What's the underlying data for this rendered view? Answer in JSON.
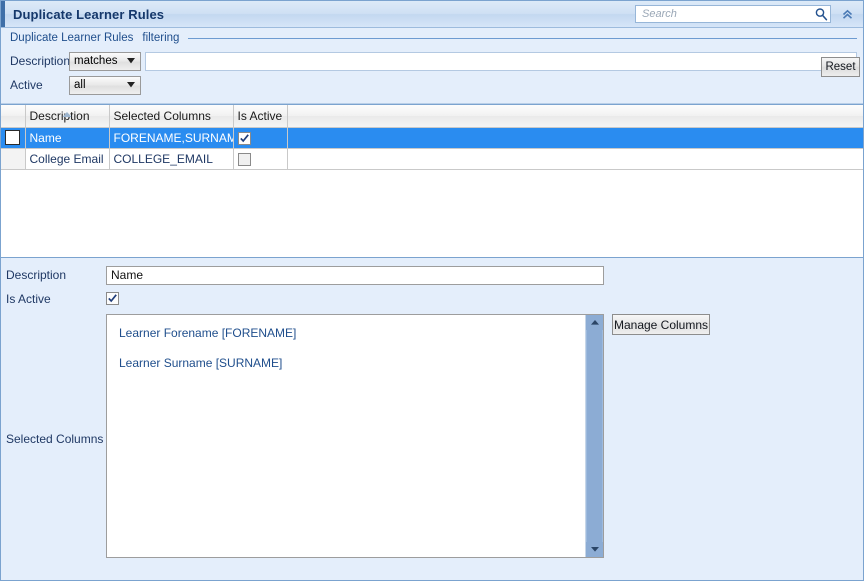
{
  "window": {
    "title": "Duplicate Learner Rules",
    "collapse_icon": "double-chevron-up-icon"
  },
  "search": {
    "placeholder": "Search",
    "value": "",
    "icon": "magnifier-icon"
  },
  "filter": {
    "group_title": "Duplicate Learner Rules",
    "group_subtitle": "filtering",
    "reset_label": "Reset",
    "rows": [
      {
        "label": "Description",
        "operator": "matches",
        "value": "",
        "has_text_input": true
      },
      {
        "label": "Active",
        "operator": "all",
        "has_text_input": false
      }
    ]
  },
  "grid": {
    "columns": [
      {
        "key": "selector",
        "label": ""
      },
      {
        "key": "description",
        "label": "Description",
        "sorted": "asc"
      },
      {
        "key": "selected_columns",
        "label": "Selected Columns"
      },
      {
        "key": "is_active",
        "label": "Is Active"
      },
      {
        "key": "filler",
        "label": ""
      }
    ],
    "rows": [
      {
        "description": "Name",
        "selected_columns": "FORENAME,SURNAME",
        "is_active": true,
        "selected": true
      },
      {
        "description": "College Email",
        "selected_columns": "COLLEGE_EMAIL",
        "is_active": false,
        "selected": false
      }
    ]
  },
  "detail": {
    "description_label": "Description",
    "description_value": "Name",
    "is_active_label": "Is Active",
    "is_active_value": true,
    "selected_columns_label": "Selected Columns",
    "selected_columns_items": [
      "Learner Forename [FORENAME]",
      "Learner Surname [SURNAME]"
    ],
    "manage_columns_label": "Manage Columns"
  },
  "colors": {
    "accent": "#3f6fa8",
    "panel_bg": "#e4eefb",
    "selection": "#2a8cf0",
    "label_text": "#1f3864",
    "link_text": "#1f4e8c"
  }
}
